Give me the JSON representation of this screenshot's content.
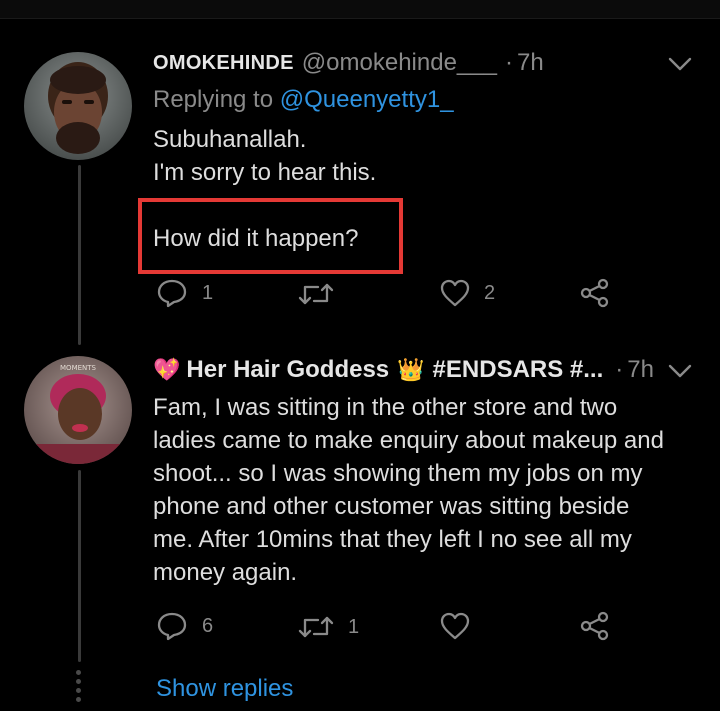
{
  "tweet1": {
    "name": "OMOKEHINDE",
    "handle": "@omokehinde___",
    "separator": "·",
    "time": "7h",
    "replying_prefix": "Replying to",
    "replying_to": "@Queenyetty1_",
    "text_line1": "Subuhanallah.",
    "text_line2": "I'm sorry to hear this.",
    "text_highlight": "How did it happen?",
    "reply_count": "1",
    "retweet_count": "",
    "like_count": "2"
  },
  "tweet2": {
    "name_emoji_heart": "💖",
    "name": "Her Hair Goddess",
    "name_emoji_crown": "👑",
    "name_tail": "#ENDSARS #...",
    "separator": "·",
    "time": "7h",
    "text_lines": [
      "Fam, I was sitting in the other store and two",
      "ladies came to make enquiry about makeup and",
      "shoot... so I was showing them my jobs on my",
      "phone and other customer was sitting beside",
      "me. After 10mins that they left I no see all my",
      "money again."
    ],
    "reply_count": "6",
    "retweet_count": "1",
    "like_count": ""
  },
  "show_replies": "Show replies",
  "colors": {
    "background": "#000000",
    "link": "#2f93e0",
    "muted": "#8a8a8a",
    "highlight_border": "#e53935"
  },
  "icons": [
    "reply-icon",
    "retweet-icon",
    "like-icon",
    "share-icon",
    "chevron-down-icon"
  ]
}
